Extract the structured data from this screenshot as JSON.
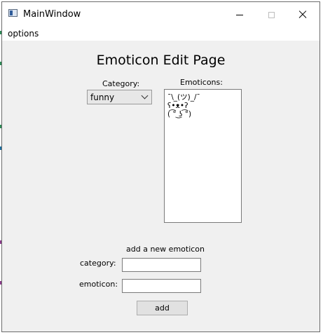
{
  "window": {
    "title": "MainWindow",
    "controls": {
      "minimize": "minimize",
      "maximize": "maximize",
      "close": "close"
    }
  },
  "menubar": {
    "items": [
      {
        "label": "options"
      }
    ]
  },
  "page": {
    "title": "Emoticon Edit Page",
    "category_label": "Category:",
    "category_selected": "funny",
    "emoticons_label": "Emoticons:",
    "emoticons": [
      "¯\\_(ツ)_/¯",
      "ʕ•ᴥ•ʔ",
      "( ͡° ͜ʖ ͡°)"
    ]
  },
  "add_form": {
    "heading": "add a new emoticon",
    "category_label": "category:",
    "category_value": "",
    "emoticon_label": "emoticon:",
    "emoticon_value": "",
    "add_button_label": "add"
  },
  "colors": {
    "window_background": "#f0f0f0",
    "titlebar_background": "#ffffff",
    "button_background": "#e1e1e1",
    "gutter_marks": [
      "#2e8b57",
      "#2e8b57",
      "#1e6e9e",
      "#8b3a8b",
      "#8b3a8b"
    ]
  }
}
